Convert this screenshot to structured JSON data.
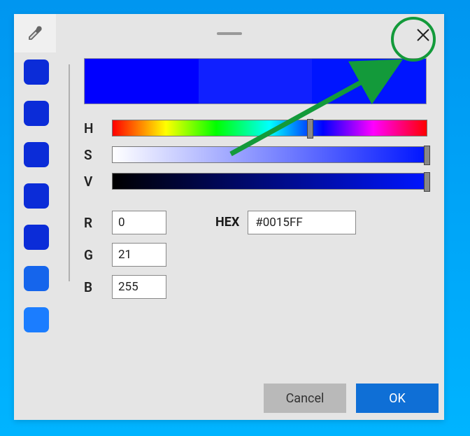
{
  "swatches": [
    {
      "color": "#0b2cd8"
    },
    {
      "color": "#0b2cd8"
    },
    {
      "color": "#0b2cd8"
    },
    {
      "color": "#0b2cd8"
    },
    {
      "color": "#0b2cd8"
    },
    {
      "color": "#1565ec"
    },
    {
      "color": "#1b7dff"
    }
  ],
  "preview": {
    "left": "#0000ff",
    "mid": "#1020ff",
    "right": "#0015ff"
  },
  "sliders": {
    "h": {
      "label": "H",
      "thumb_pct": 62
    },
    "s": {
      "label": "S",
      "thumb_pct": 99
    },
    "v": {
      "label": "V",
      "thumb_pct": 99
    }
  },
  "rgb": {
    "r": {
      "label": "R",
      "value": "0"
    },
    "g": {
      "label": "G",
      "value": "21"
    },
    "b": {
      "label": "B",
      "value": "255"
    }
  },
  "hex": {
    "label": "HEX",
    "value": "#0015FF"
  },
  "buttons": {
    "cancel": "Cancel",
    "ok": "OK"
  }
}
